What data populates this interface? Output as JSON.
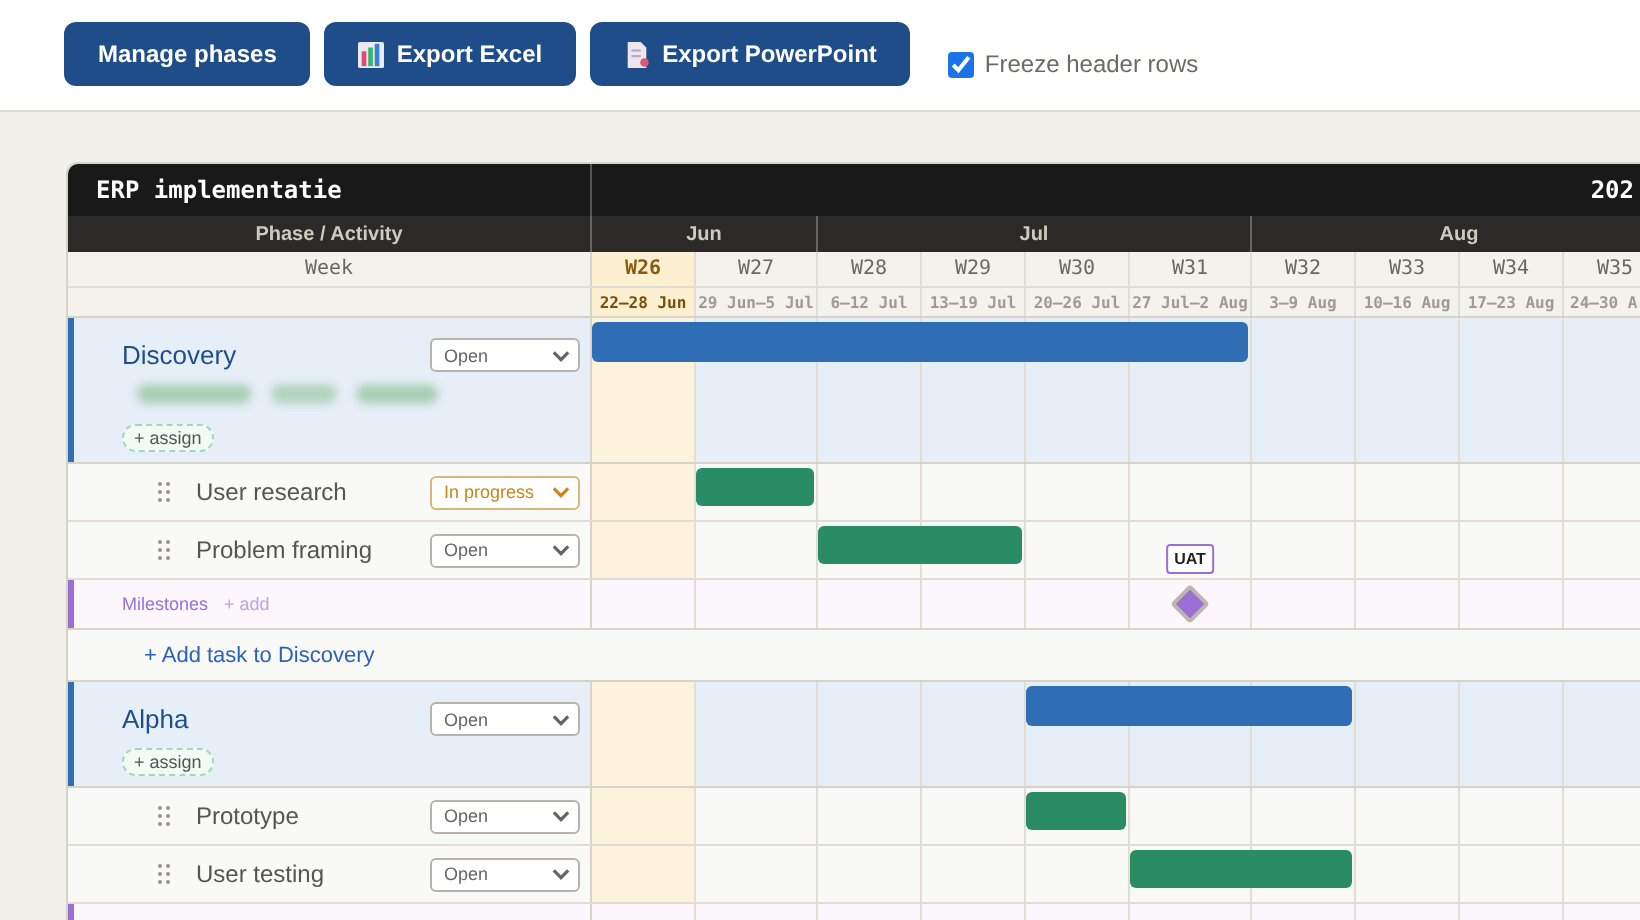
{
  "toolbar": {
    "buttons": [
      {
        "label": "Manage phases",
        "kind": "plain"
      },
      {
        "label": "Export Excel",
        "kind": "excel"
      },
      {
        "label": "Export PowerPoint",
        "kind": "powerpoint"
      }
    ],
    "freeze": {
      "label": "Freeze header rows",
      "checked": true
    }
  },
  "gantt": {
    "title": "ERP implementatie",
    "year": "202",
    "column_label": "Phase / Activity",
    "week_label": "Week",
    "months": [
      {
        "label": "Jun",
        "weeks": [
          {
            "label": "W26",
            "dates": "22–28 Jun",
            "current": true
          },
          {
            "label": "W27",
            "dates": "29 Jun–5 Jul",
            "current": false
          }
        ]
      },
      {
        "label": "Jul",
        "weeks": [
          {
            "label": "W28",
            "dates": "6–12 Jul",
            "current": false
          },
          {
            "label": "W29",
            "dates": "13–19 Jul",
            "current": false
          },
          {
            "label": "W30",
            "dates": "20–26 Jul",
            "current": false
          },
          {
            "label": "W31",
            "dates": "27 Jul–2 Aug",
            "current": false
          }
        ]
      },
      {
        "label": "Aug",
        "weeks": [
          {
            "label": "W32",
            "dates": "3–9 Aug",
            "current": false
          },
          {
            "label": "W33",
            "dates": "10–16 Aug",
            "current": false
          },
          {
            "label": "W34",
            "dates": "17–23 Aug",
            "current": false
          },
          {
            "label": "W35",
            "dates": "24–30 A",
            "current": false
          }
        ]
      }
    ],
    "rows": [
      {
        "kind": "phase",
        "name": "Discovery",
        "status": {
          "label": "Open",
          "kind": "open"
        },
        "assign": "+ assign",
        "blurred": true,
        "weeks": [
          true,
          true,
          true,
          true,
          true,
          true,
          false,
          false,
          false,
          false
        ]
      },
      {
        "kind": "task",
        "name": "User research",
        "status": {
          "label": "In progress",
          "kind": "progress"
        },
        "weeks": [
          false,
          true,
          false,
          false,
          false,
          false,
          false,
          false,
          false,
          false
        ]
      },
      {
        "kind": "task",
        "name": "Problem framing",
        "status": {
          "label": "Open",
          "kind": "open"
        },
        "weeks": [
          false,
          false,
          true,
          true,
          false,
          false,
          false,
          false,
          false,
          false
        ]
      },
      {
        "kind": "milestones",
        "label": "Milestones",
        "add": "+ add",
        "milestones": [
          {
            "label": "UAT",
            "weeks": [
              false,
              false,
              false,
              false,
              false,
              true,
              false,
              false,
              false,
              false
            ]
          }
        ]
      },
      {
        "kind": "add_task",
        "label": "+ Add task to Discovery"
      },
      {
        "kind": "phase",
        "name": "Alpha",
        "status": {
          "label": "Open",
          "kind": "open"
        },
        "assign": "+ assign",
        "blurred": false,
        "weeks": [
          false,
          false,
          false,
          false,
          true,
          true,
          true,
          false,
          false,
          false
        ]
      },
      {
        "kind": "task",
        "name": "Prototype",
        "status": {
          "label": "Open",
          "kind": "open"
        },
        "weeks": [
          false,
          false,
          false,
          false,
          true,
          false,
          false,
          false,
          false,
          false
        ]
      },
      {
        "kind": "task",
        "name": "User testing",
        "status": {
          "label": "Open",
          "kind": "open"
        },
        "weeks": [
          false,
          false,
          false,
          false,
          false,
          true,
          true,
          false,
          false,
          false
        ]
      },
      {
        "kind": "milestones"
      }
    ]
  }
}
